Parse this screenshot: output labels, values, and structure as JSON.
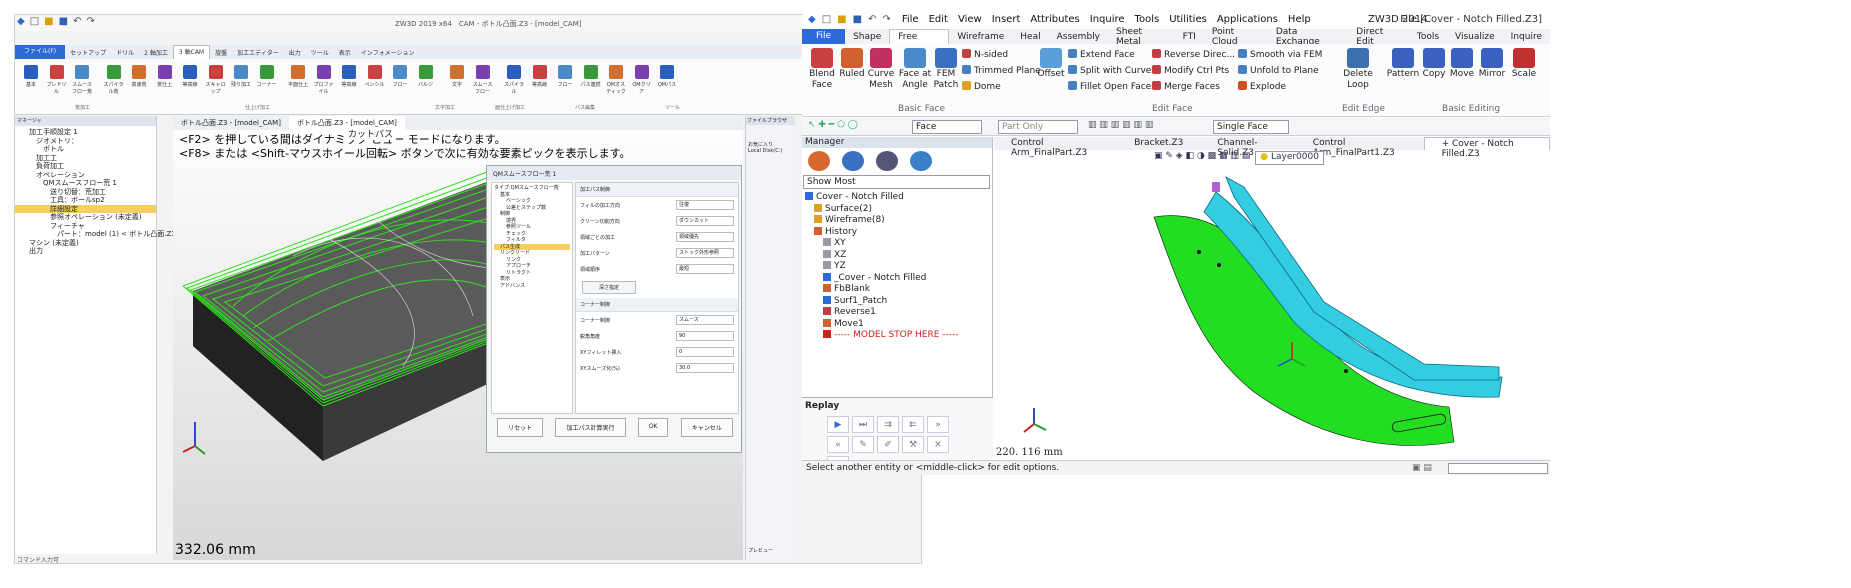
{
  "left": {
    "title": "ZW3D 2019 x64　CAM - ボトル凸面.Z3 - [model_CAM]",
    "menu_tabs": [
      "ファイル(F)",
      "セットアップ",
      "ドリル",
      "2 軸加工",
      "3 軸CAM",
      "旋盤",
      "加工エディター",
      "出力",
      "ツール",
      "表示",
      "インフォメーション"
    ],
    "ribbon_buttons": [
      "基本",
      "プレドリル",
      "スムースフロー荒",
      "スパイラル荒",
      "高速荒",
      "荒仕上",
      "等高線",
      "スキャロップ",
      "残り加工",
      "コーナー",
      "平面仕上",
      "プロファイル",
      "等高線",
      "ペンシル",
      "フロー",
      "バルジ",
      "文字",
      "スムースフロー",
      "スパイラル",
      "等高線",
      "フロー",
      "パス連続",
      "QMオスティック",
      "QMクリア",
      "QMパス"
    ],
    "ribbon_groups": [
      "荒加工",
      "仕上げ加工",
      "文字加工",
      "面仕上げ加工",
      "パス編集",
      "ツール"
    ],
    "manager_title": "マネージャ",
    "tree": [
      "加工手順設定 1",
      "ジオメトリ：",
      "ボトル",
      "加工工",
      "負荷加工",
      "オペレーション",
      "QMスムースフロー荒 1",
      "送り切替：荒加工",
      "工具：ボールsp2",
      "詳細設定",
      "参照オペレーション (未定義)",
      "フィーチャ",
      "パート：model (1) < ボトル凸面.Z3",
      "マシン (未定義)",
      "出力"
    ],
    "doc_tabs": [
      "ボトル凸面.Z3 - [model_CAM]",
      "ボトル凸面.Z3 - [model_CAM]"
    ],
    "hint1": "<F2> を押している間はダイナミック ビュー モードになります。",
    "hint2": "<F8> または <Shift-マウスホイール回転> ボタンで次に有効な要素ピックを表示します。",
    "cut_path": "カットパス",
    "scale": "332.06 mm",
    "dialog": {
      "title": "QMスムースフロー荒 1",
      "tree": [
        "タイプ:QMスムースフロー荒",
        "基本",
        "ベーシック",
        "公差とステップ数",
        "制御",
        "境界",
        "参照ツール",
        "チェック",
        "フィルタ",
        "パス生成",
        "リンクリード",
        "リンク",
        "アプローチ",
        "リトラクト",
        "表示",
        "アドバンス"
      ],
      "sections": [
        "加工パス制御",
        "コーナー制御"
      ],
      "rows": [
        [
          "フィルの加工方向",
          "往復"
        ],
        [
          "クリーン切削方向",
          "ダウンカット"
        ],
        [
          "領域ごとの加工",
          "領域優先"
        ],
        [
          "加工パターン",
          "ストック外形参照"
        ],
        [
          "領域順序",
          "最短"
        ],
        [
          "コーナー制御",
          "スムース"
        ],
        [
          "鋭角角度",
          "90"
        ],
        [
          "XYフィレット挿入",
          "0"
        ],
        [
          "XYスムーズ化(%)",
          "30.0"
        ]
      ],
      "inner_button": "深さ指定",
      "buttons": [
        "リセット",
        "加工パス計算実行",
        "OK",
        "キャンセル"
      ]
    },
    "file_browser": "ファイルブラウザ",
    "file_items": [
      "お気に入り",
      "Local Disk(C:)"
    ],
    "preview": "プレビュー",
    "status": "コマンド入力可"
  },
  "right": {
    "quick_menu": [
      "File",
      "Edit",
      "View",
      "Insert",
      "Attributes",
      "Inquire",
      "Tools",
      "Utilities",
      "Applications",
      "Help"
    ],
    "app": "ZW3D 2014",
    "file_title": "File [Cover - Notch Filled.Z3]",
    "tabs": [
      "File",
      "Shape",
      "Free Form",
      "Wireframe",
      "Heal",
      "Assembly",
      "Sheet Metal",
      "FTI",
      "Point Cloud",
      "Data Exchange",
      "Direct Edit",
      "Tools",
      "Visualize",
      "Inquire"
    ],
    "active_tab": "Free Form",
    "big_buttons": [
      [
        "Blend",
        "Face"
      ],
      [
        "Ruled",
        ""
      ],
      [
        "Curve",
        "Mesh"
      ],
      [
        "Face at",
        "Angle"
      ],
      [
        "FEM",
        "Patch"
      ],
      [
        "Offset",
        ""
      ],
      [
        "Delete",
        "Loop"
      ],
      [
        "Pattern",
        ""
      ],
      [
        "Copy",
        ""
      ],
      [
        "Move",
        ""
      ],
      [
        "Mirror",
        ""
      ],
      [
        "Scale",
        ""
      ]
    ],
    "small_buttons": [
      "N-sided",
      "Trimmed Plane",
      "Dome",
      "Extend Face",
      "Split with Curves",
      "Fillet Open Faces",
      "Reverse Direc...",
      "Modify Ctrl Pts",
      "Merge Faces",
      "Smooth via FEM",
      "Unfold to Plane",
      "Explode"
    ],
    "groups": [
      "Basic Face",
      "Edit Face",
      "Edit Edge",
      "Basic Editing"
    ],
    "filter1": "Face",
    "filter2": "Part Only",
    "filter3": "Single Face",
    "manager": "Manager",
    "show": "Show Most",
    "tree": [
      [
        "Cover - Notch Filled",
        0
      ],
      [
        "Surface(2)",
        1
      ],
      [
        "Wireframe(8)",
        1
      ],
      [
        "History",
        1
      ],
      [
        "XY",
        2
      ],
      [
        "XZ",
        2
      ],
      [
        "YZ",
        2
      ],
      [
        "_Cover - Notch Filled",
        2
      ],
      [
        "FbBlank",
        2
      ],
      [
        "Surf1_Patch",
        2
      ],
      [
        "Reverse1",
        2
      ],
      [
        "Move1",
        2
      ],
      [
        "----- MODEL STOP HERE -----",
        2
      ]
    ],
    "replay": "Replay",
    "doc_tabs": [
      "Control Arm_FinalPart.Z3",
      "Bracket.Z3",
      "Channel-Solid.Z3",
      "Control Arm_FinalPart1.Z3",
      "+ Cover - Notch Filled.Z3"
    ],
    "layer": "Layer0000",
    "scale": "220. 116 mm",
    "status": "Select another entity or <middle-click> for edit options."
  }
}
